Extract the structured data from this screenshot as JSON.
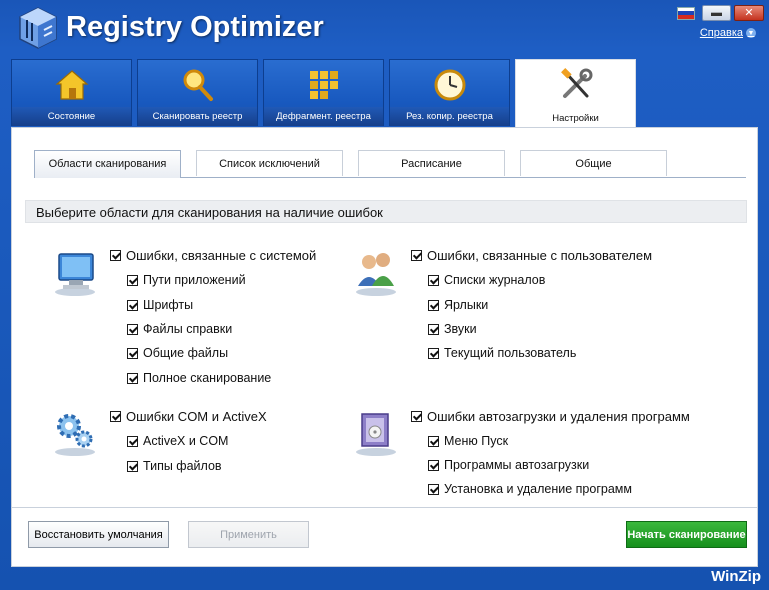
{
  "app": {
    "title": "Registry Optimizer",
    "brand": "WinZip",
    "help_label": "Справка"
  },
  "colors": {
    "titlebar": "#1e5ec4",
    "primary_button": "#1f9a25",
    "tab_bar": "#195ac0"
  },
  "main_tabs": [
    {
      "label": "Состояние",
      "icon": "house-icon"
    },
    {
      "label": "Сканировать реестр",
      "icon": "magnifier-icon"
    },
    {
      "label": "Дефрагмент. реестра",
      "icon": "defrag-blocks-icon"
    },
    {
      "label": "Рез. копир. реестра",
      "icon": "backup-clock-icon"
    },
    {
      "label": "Настройки",
      "icon": "tools-icon",
      "active": true
    }
  ],
  "sub_tabs": [
    {
      "label": "Области сканирования",
      "active": true
    },
    {
      "label": "Список исключений"
    },
    {
      "label": "Расписание"
    },
    {
      "label": "Общие"
    }
  ],
  "section_title": "Выберите области для сканирования на наличие ошибок",
  "groups": {
    "system": {
      "icon": "computer-icon",
      "title": "Ошибки, связанные с системой",
      "items": [
        "Пути приложений",
        "Шрифты",
        "Файлы справки",
        "Общие файлы",
        "Полное сканирование"
      ]
    },
    "user": {
      "icon": "users-icon",
      "title": "Ошибки, связанные с пользователем",
      "items": [
        "Списки журналов",
        "Ярлыки",
        "Звуки",
        "Текущий пользователь"
      ]
    },
    "com": {
      "icon": "gears-icon",
      "title": "Ошибки COM и ActiveX",
      "items": [
        "ActiveX и COM",
        "Типы файлов"
      ]
    },
    "startup": {
      "icon": "install-box-icon",
      "title": "Ошибки автозагрузки и удаления программ",
      "items": [
        "Меню Пуск",
        "Программы автозагрузки",
        "Установка и удаление программ"
      ]
    }
  },
  "buttons": {
    "restore_defaults": "Восстановить умолчания",
    "apply": "Применить",
    "start_scan": "Начать сканирование"
  }
}
